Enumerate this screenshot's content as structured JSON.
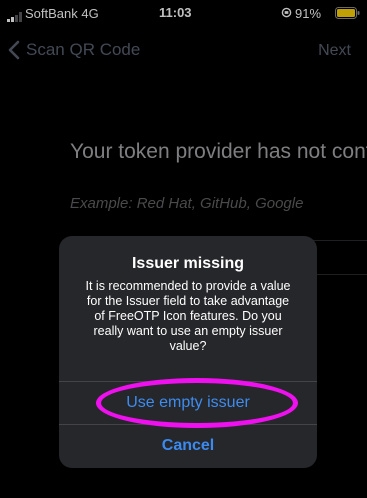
{
  "status_bar": {
    "carrier": "SoftBank  4G",
    "time": "11:03",
    "battery": "91%",
    "battery_color": "#ffd60a"
  },
  "nav": {
    "back_label": "Scan QR Code",
    "next_label": "Next",
    "back_icon": "chevron-left-icon"
  },
  "background": {
    "heading": "Your token provider has not configured",
    "placeholder": "Example: Red Hat, GitHub, Google"
  },
  "alert": {
    "title": "Issuer missing",
    "message": "It is recommended to provide a value for the Issuer field to take advantage of FreeOTP Icon features. Do you really want to use an empty issuer value?",
    "actions": [
      {
        "label": "Use empty issuer"
      },
      {
        "label": "Cancel"
      }
    ]
  },
  "highlight": {
    "color": "#ee10ee"
  }
}
